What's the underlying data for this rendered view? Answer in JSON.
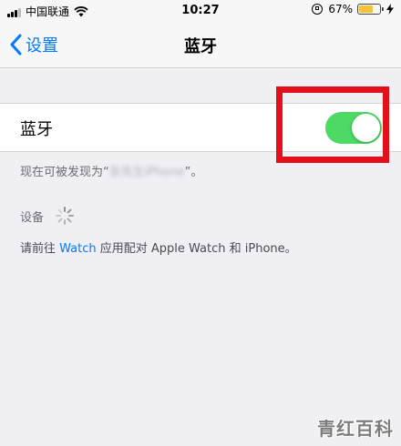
{
  "status_bar": {
    "carrier": "中国联通",
    "time": "10:27",
    "battery": "67%",
    "battery_level": 0.67,
    "battery_color": "#f5c33b"
  },
  "nav": {
    "back_label": "设置",
    "title": "蓝牙"
  },
  "bluetooth": {
    "label": "蓝牙",
    "toggle_on": true,
    "toggle_color": "#4cd964"
  },
  "discoverable": {
    "prefix": "现在可被发现为“",
    "device_name": "张先生iPhone",
    "suffix": "”。"
  },
  "devices": {
    "header": "设备"
  },
  "pair_hint": {
    "prefix": "请前往 ",
    "link": "Watch",
    "suffix": " 应用配对 Apple Watch 和 iPhone。"
  },
  "highlight_color": "#e3101c",
  "accent_color": "#007aff",
  "watermark": "青红百科"
}
